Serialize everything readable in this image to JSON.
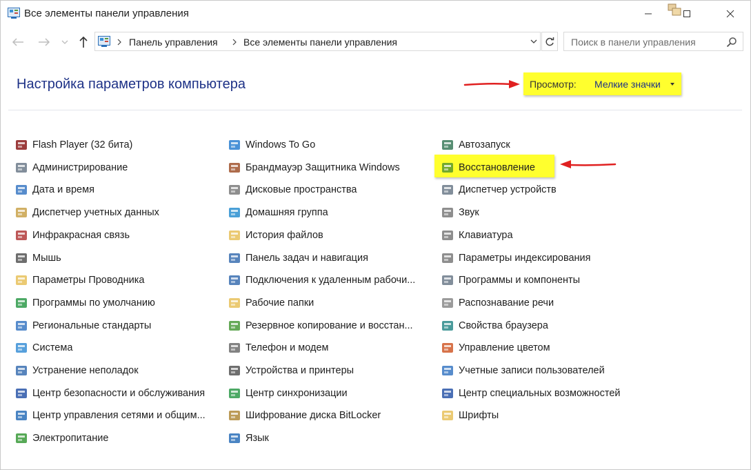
{
  "window": {
    "title": "Все элементы панели управления"
  },
  "address": {
    "segments": [
      "Панель управления",
      "Все элементы панели управления"
    ]
  },
  "search": {
    "placeholder": "Поиск в панели управления"
  },
  "header": {
    "title": "Настройка параметров компьютера",
    "view_label": "Просмотр:",
    "view_value": "Мелкие значки"
  },
  "columns": [
    [
      {
        "label": "Flash Player (32 бита)",
        "icon": "flash-icon",
        "color": "#8b1a1a"
      },
      {
        "label": "Администрирование",
        "icon": "admin-tools-icon",
        "color": "#6c7a8a"
      },
      {
        "label": "Дата и время",
        "icon": "clock-icon",
        "color": "#3a78c3"
      },
      {
        "label": "Диспетчер учетных данных",
        "icon": "credential-icon",
        "color": "#c9a24a"
      },
      {
        "label": "Инфракрасная связь",
        "icon": "infrared-icon",
        "color": "#b23a3a"
      },
      {
        "label": "Мышь",
        "icon": "mouse-icon",
        "color": "#555555"
      },
      {
        "label": "Параметры Проводника",
        "icon": "folder-options-icon",
        "color": "#e8c15a"
      },
      {
        "label": "Программы по умолчанию",
        "icon": "default-programs-icon",
        "color": "#2e9a4a"
      },
      {
        "label": "Региональные стандарты",
        "icon": "globe-clock-icon",
        "color": "#3a78c3"
      },
      {
        "label": "Система",
        "icon": "computer-icon",
        "color": "#3a8fd6"
      },
      {
        "label": "Устранение неполадок",
        "icon": "troubleshoot-icon",
        "color": "#3a6fb0"
      },
      {
        "label": "Центр безопасности и обслуживания",
        "icon": "flag-icon",
        "color": "#2a56a8"
      },
      {
        "label": "Центр управления сетями и общим...",
        "icon": "network-icon",
        "color": "#2a6fb8"
      },
      {
        "label": "Электропитание",
        "icon": "power-icon",
        "color": "#3a9a3a"
      }
    ],
    [
      {
        "label": "Windows To Go",
        "icon": "windows-to-go-icon",
        "color": "#2a7fd0"
      },
      {
        "label": "Брандмауэр Защитника Windows",
        "icon": "firewall-icon",
        "color": "#a0522d"
      },
      {
        "label": "Дисковые пространства",
        "icon": "storage-icon",
        "color": "#7a7a7a"
      },
      {
        "label": "Домашняя группа",
        "icon": "homegroup-icon",
        "color": "#2a8fd0"
      },
      {
        "label": "История файлов",
        "icon": "file-history-icon",
        "color": "#e8c15a"
      },
      {
        "label": "Панель задач и навигация",
        "icon": "taskbar-icon",
        "color": "#3a6fb0"
      },
      {
        "label": "Подключения к удаленным рабочи...",
        "icon": "remote-desktop-icon",
        "color": "#3a6fb0"
      },
      {
        "label": "Рабочие папки",
        "icon": "work-folders-icon",
        "color": "#e8c15a"
      },
      {
        "label": "Резервное копирование и восстан...",
        "icon": "backup-icon",
        "color": "#4a9a3a"
      },
      {
        "label": "Телефон и модем",
        "icon": "phone-icon",
        "color": "#6c6c6c"
      },
      {
        "label": "Устройства и принтеры",
        "icon": "printer-icon",
        "color": "#555555"
      },
      {
        "label": "Центр синхронизации",
        "icon": "sync-icon",
        "color": "#2e9a4a"
      },
      {
        "label": "Шифрование диска BitLocker",
        "icon": "bitlocker-icon",
        "color": "#b08a3a"
      },
      {
        "label": "Язык",
        "icon": "language-icon",
        "color": "#2a6fb8"
      }
    ],
    [
      {
        "label": "Автозапуск",
        "icon": "autoplay-icon",
        "color": "#3a7a5a"
      },
      {
        "label": "Восстановление",
        "icon": "recovery-icon",
        "color": "#5a9a2a"
      },
      {
        "label": "Диспетчер устройств",
        "icon": "device-manager-icon",
        "color": "#6c7a8a"
      },
      {
        "label": "Звук",
        "icon": "speaker-icon",
        "color": "#7a7a7a"
      },
      {
        "label": "Клавиатура",
        "icon": "keyboard-icon",
        "color": "#7a7a7a"
      },
      {
        "label": "Параметры индексирования",
        "icon": "indexing-icon",
        "color": "#7a7a7a"
      },
      {
        "label": "Программы и компоненты",
        "icon": "programs-icon",
        "color": "#6c7a8a"
      },
      {
        "label": "Распознавание речи",
        "icon": "microphone-icon",
        "color": "#8a8a8a"
      },
      {
        "label": "Свойства браузера",
        "icon": "browser-icon",
        "color": "#2a8a8a"
      },
      {
        "label": "Управление цветом",
        "icon": "color-icon",
        "color": "#d05a2a"
      },
      {
        "label": "Учетные записи пользователей",
        "icon": "users-icon",
        "color": "#3a78c3"
      },
      {
        "label": "Центр специальных возможностей",
        "icon": "accessibility-icon",
        "color": "#2a56a8"
      },
      {
        "label": "Шрифты",
        "icon": "fonts-icon",
        "color": "#e8c15a"
      }
    ]
  ]
}
